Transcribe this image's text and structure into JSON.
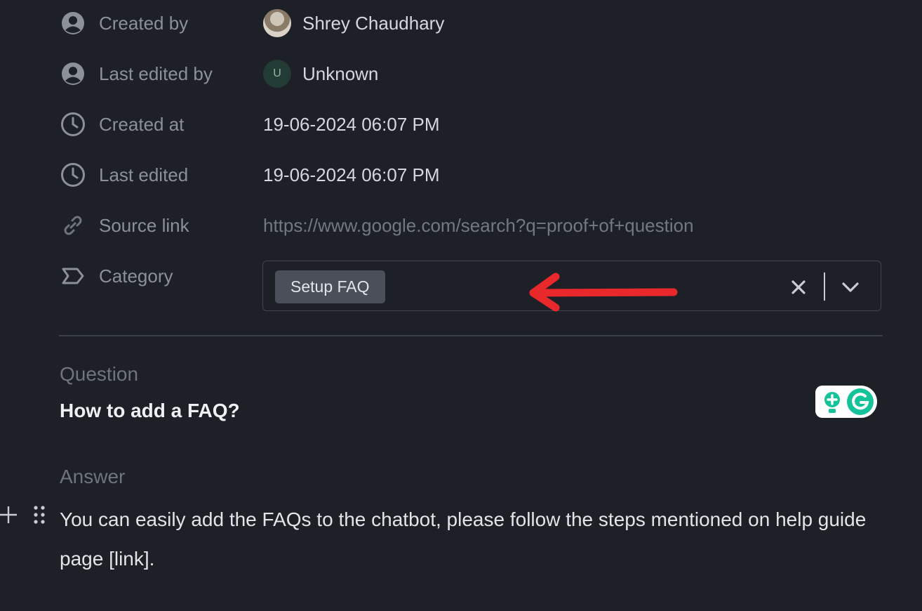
{
  "properties": {
    "created_by": {
      "label": "Created by",
      "value": "Shrey Chaudhary",
      "icon": "person-circle-icon"
    },
    "last_edited_by": {
      "label": "Last edited by",
      "value": "Unknown",
      "avatar_letter": "U",
      "icon": "person-circle-icon"
    },
    "created_at": {
      "label": "Created at",
      "value": "19-06-2024 06:07 PM",
      "icon": "clock-icon"
    },
    "last_edited": {
      "label": "Last edited",
      "value": "19-06-2024 06:07 PM",
      "icon": "clock-icon"
    },
    "source_link": {
      "label": "Source link",
      "value": "https://www.google.com/search?q=proof+of+question",
      "icon": "link-icon"
    },
    "category": {
      "label": "Category",
      "selected": "Setup FAQ",
      "icon": "tag-icon"
    }
  },
  "question": {
    "label": "Question",
    "text": "How to add a FAQ?"
  },
  "answer": {
    "label": "Answer",
    "text": "You can easily add the FAQs to the chatbot, please follow the steps mentioned on help guide page [link]."
  },
  "annotation": {
    "icon": "red-arrow-icon",
    "color": "#e8282b"
  },
  "colors": {
    "background": "#1d2027",
    "chip": "#4a4f59",
    "grammarly": "#15c39a"
  }
}
